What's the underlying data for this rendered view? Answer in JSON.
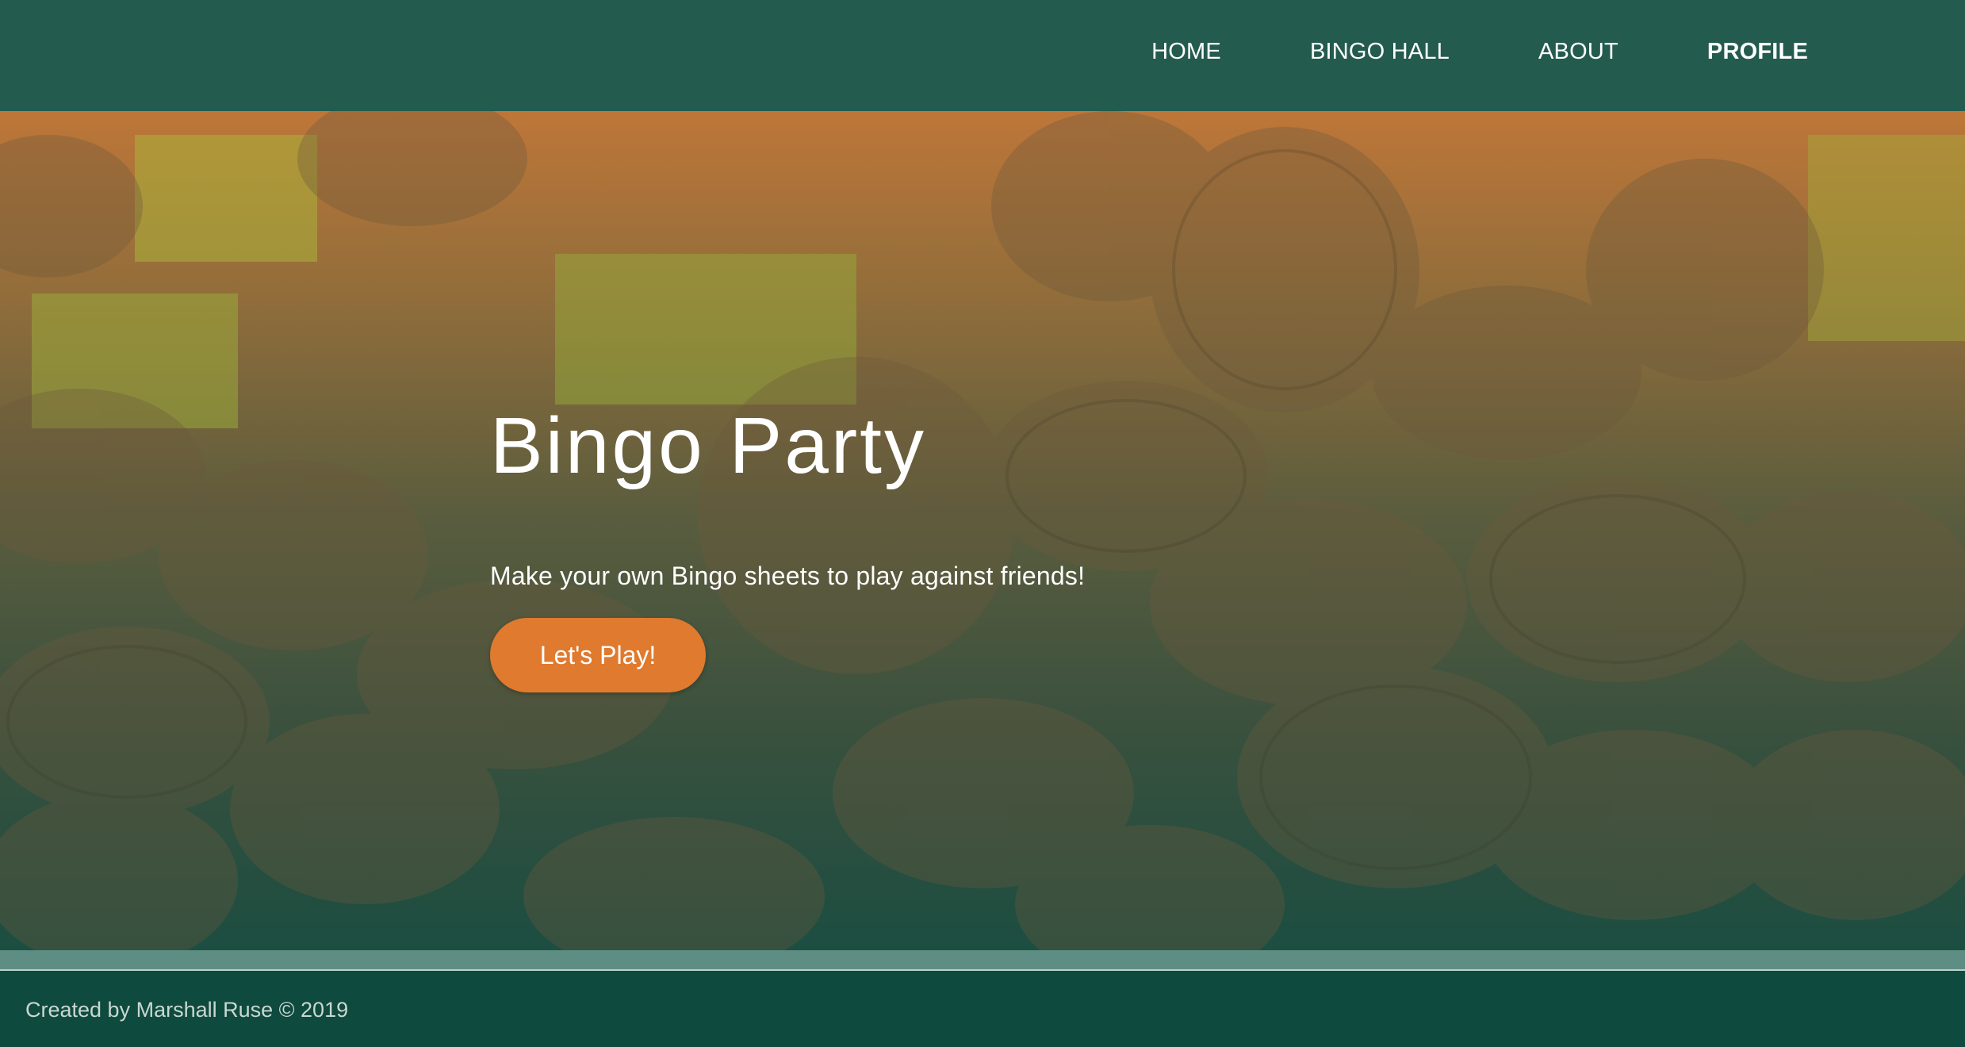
{
  "nav": {
    "items": [
      {
        "label": "HOME"
      },
      {
        "label": "BINGO HALL"
      },
      {
        "label": "ABOUT"
      },
      {
        "label": "PROFILE"
      }
    ]
  },
  "hero": {
    "title": "Bingo Party",
    "subtitle": "Make your own Bingo sheets to play against friends!",
    "button_label": "Let's Play!",
    "background_image_description": "wooden bingo tokens"
  },
  "footer": {
    "text": "Created by Marshall Ruse © 2019"
  },
  "colors": {
    "navbar": "#245b4f",
    "footer": "#0e4a3d",
    "accent": "#e07a2e",
    "band": "#5e8e83"
  }
}
